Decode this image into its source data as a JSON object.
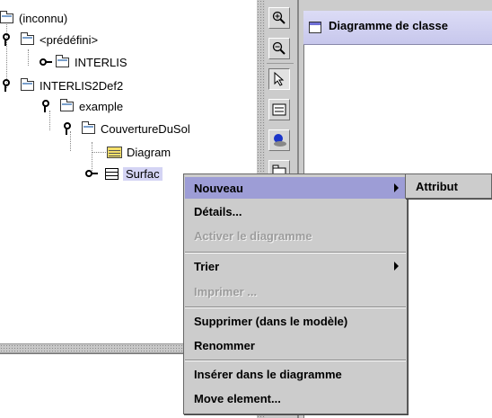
{
  "tree": {
    "items": [
      {
        "label": "(inconnu)"
      },
      {
        "label": "<prédéfini>"
      },
      {
        "label": "INTERLIS"
      },
      {
        "label": "INTERLIS2Def2"
      },
      {
        "label": "example"
      },
      {
        "label": "CouvertureDuSol"
      },
      {
        "label": "Diagram"
      },
      {
        "label": "Surfac"
      }
    ]
  },
  "diagram": {
    "tab_title": "Diagramme de classe"
  },
  "toolbar": {
    "tools": [
      "zoom-in-icon",
      "zoom-out-icon",
      "select-arrow-icon",
      "note-icon",
      "class-palette-icon",
      "package-icon"
    ]
  },
  "context_menu": {
    "items": [
      {
        "label": "Nouveau",
        "highlighted": true,
        "submenu": true
      },
      {
        "label": "Détails..."
      },
      {
        "label": "Activer le diagramme",
        "disabled": true
      },
      {
        "label": "Trier",
        "submenu": true
      },
      {
        "label": "Imprimer ...",
        "disabled": true
      },
      {
        "label": "Supprimer (dans le modèle)"
      },
      {
        "label": "Renommer"
      },
      {
        "label": "Insérer dans le diagramme"
      },
      {
        "label": "Move element..."
      }
    ],
    "submenu": {
      "label": "Attribut"
    }
  },
  "colors": {
    "menu_background": "#cccccc",
    "highlight": "#9d9dd6",
    "tab_gradient": "#d5d5f2",
    "disabled_text": "#9c9c9c"
  }
}
